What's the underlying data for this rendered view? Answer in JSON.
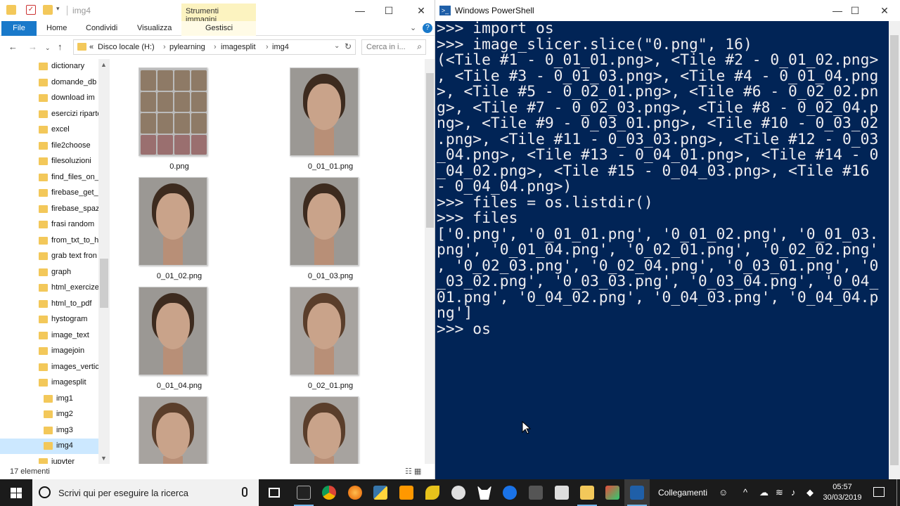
{
  "explorer": {
    "window_title": "img4",
    "context_tab": "Strumenti immagini",
    "ribbon_tabs": [
      "File",
      "Home",
      "Condividi",
      "Visualizza",
      "Gestisci"
    ],
    "address": {
      "crumbs": [
        "«",
        "Disco locale (H:)",
        "pylearning",
        "imagesplit",
        "img4"
      ]
    },
    "search_placeholder": "Cerca in i...",
    "nav_items": [
      {
        "label": "dictionary",
        "indent": false
      },
      {
        "label": "domande_db",
        "indent": false
      },
      {
        "label": "download im",
        "indent": false
      },
      {
        "label": "esercizi riparte",
        "indent": false
      },
      {
        "label": "excel",
        "indent": false
      },
      {
        "label": "file2choose",
        "indent": false
      },
      {
        "label": "filesoluzioni",
        "indent": false
      },
      {
        "label": "find_files_on_",
        "indent": false
      },
      {
        "label": "firebase_get_c",
        "indent": false
      },
      {
        "label": "firebase_spazi",
        "indent": false
      },
      {
        "label": "frasi random",
        "indent": false
      },
      {
        "label": "from_txt_to_h",
        "indent": false
      },
      {
        "label": "grab text fron",
        "indent": false
      },
      {
        "label": "graph",
        "indent": false
      },
      {
        "label": "html_exercize",
        "indent": false
      },
      {
        "label": "html_to_pdf",
        "indent": false
      },
      {
        "label": "hystogram",
        "indent": false
      },
      {
        "label": "image_text",
        "indent": false
      },
      {
        "label": "imagejoin",
        "indent": false
      },
      {
        "label": "images_vertic",
        "indent": false
      },
      {
        "label": "imagesplit",
        "indent": false
      },
      {
        "label": "img1",
        "indent": true
      },
      {
        "label": "img2",
        "indent": true
      },
      {
        "label": "img3",
        "indent": true
      },
      {
        "label": "img4",
        "indent": true,
        "selected": true
      },
      {
        "label": "jupyter",
        "indent": false
      }
    ],
    "files": [
      "0.png",
      "0_01_01.png",
      "0_01_02.png",
      "0_01_03.png",
      "0_01_04.png",
      "0_02_01.png",
      "",
      ""
    ],
    "status": "17 elementi"
  },
  "powershell": {
    "window_title": "Windows PowerShell",
    "lines": [
      ">>> import os",
      ">>> image_slicer.slice(\"0.png\", 16)",
      "(<Tile #1 - 0_01_01.png>, <Tile #2 - 0_01_02.png>",
      ", <Tile #3 - 0_01_03.png>, <Tile #4 - 0_01_04.png",
      ">, <Tile #5 - 0_02_01.png>, <Tile #6 - 0_02_02.pn",
      "g>, <Tile #7 - 0_02_03.png>, <Tile #8 - 0_02_04.p",
      "ng>, <Tile #9 - 0_03_01.png>, <Tile #10 - 0_03_02",
      ".png>, <Tile #11 - 0_03_03.png>, <Tile #12 - 0_03",
      "_04.png>, <Tile #13 - 0_04_01.png>, <Tile #14 - 0",
      "_04_02.png>, <Tile #15 - 0_04_03.png>, <Tile #16 ",
      "- 0_04_04.png>)",
      ">>> files = os.listdir()",
      ">>> files",
      "['0.png', '0_01_01.png', '0_01_02.png', '0_01_03.",
      "png', '0_01_04.png', '0_02_01.png', '0_02_02.png'",
      ", '0_02_03.png', '0_02_04.png', '0_03_01.png', '0",
      "_03_02.png', '0_03_03.png', '0_03_04.png', '0_04_",
      "01.png', '0_04_02.png', '0_04_03.png', '0_04_04.p",
      "ng']",
      ">>> os"
    ]
  },
  "taskbar": {
    "search_placeholder": "Scrivi qui per eseguire la ricerca",
    "tray_label": "Collegamenti",
    "time": "05:57",
    "date": "30/03/2019"
  },
  "colors": {
    "powershell_bg": "#012456",
    "ribbon_file": "#1979ca",
    "context_tab": "#fcf3c0",
    "taskbar": "#1b1b1b"
  }
}
